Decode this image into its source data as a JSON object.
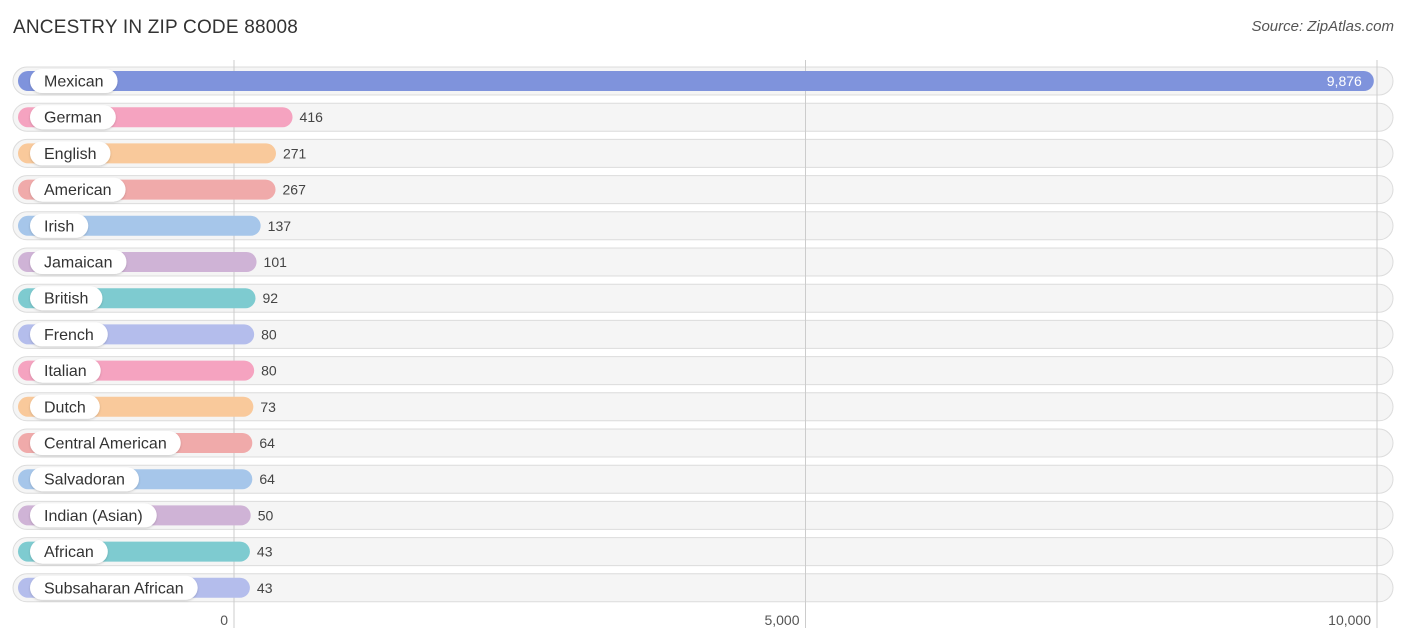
{
  "header": {
    "title": "ANCESTRY IN ZIP CODE 88008",
    "source": "Source: ZipAtlas.com"
  },
  "chart_data": {
    "type": "bar",
    "orientation": "horizontal",
    "title": "ANCESTRY IN ZIP CODE 88008",
    "xlabel": "",
    "ylabel": "",
    "xlim": [
      0,
      10000
    ],
    "x_ticks": [
      0,
      5000,
      10000
    ],
    "x_tick_labels": [
      "0",
      "5,000",
      "10,000"
    ],
    "grid": true,
    "categories": [
      "Mexican",
      "German",
      "English",
      "American",
      "Irish",
      "Jamaican",
      "British",
      "French",
      "Italian",
      "Dutch",
      "Central American",
      "Salvadoran",
      "Indian (Asian)",
      "African",
      "Subsaharan African"
    ],
    "values": [
      9876,
      416,
      271,
      267,
      137,
      101,
      92,
      80,
      80,
      73,
      64,
      64,
      50,
      43,
      43
    ],
    "value_labels": [
      "9,876",
      "416",
      "271",
      "267",
      "137",
      "101",
      "92",
      "80",
      "80",
      "73",
      "64",
      "64",
      "50",
      "43",
      "43"
    ],
    "colors": [
      "#7f93dc",
      "#f5a3c0",
      "#f9c99b",
      "#f0aaaa",
      "#a6c6ea",
      "#cfb3d6",
      "#7ecbd0",
      "#b4bdec",
      "#f5a3c0",
      "#f9c99b",
      "#f0aaaa",
      "#a6c6ea",
      "#cfb3d6",
      "#7ecbd0",
      "#b4bdec"
    ]
  }
}
